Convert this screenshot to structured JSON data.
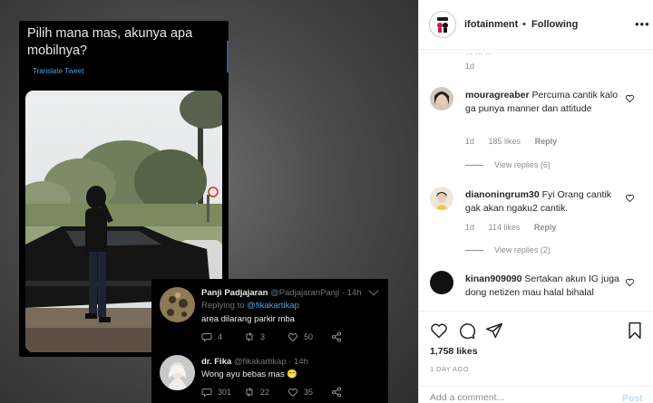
{
  "tweet": {
    "text": "Pilih mana mas, akunya apa mobilnya?",
    "translate": "Translate Tweet"
  },
  "replies": [
    {
      "name": "Panji Padjajaran",
      "handle": "@PadjajaranPanji · 14h",
      "replying_prefix": "Replying to ",
      "replying_to": "@fikakartikap",
      "text": "area dilarang parkir mba",
      "replies": "4",
      "retweets": "3",
      "likes": "50"
    },
    {
      "name": "dr. Fika",
      "handle": "@fikakartikap · 14h",
      "text": "Wong ayu bebas mas 😁",
      "replies": "301",
      "retweets": "22",
      "likes": "35"
    }
  ],
  "instagram": {
    "username": "ifotainment",
    "dot": "•",
    "follow_state": "Following",
    "faded_text": "... ... ...",
    "top_timestamp": "1d",
    "comments": [
      {
        "user": "mouragreaber",
        "text": "Percuma cantik kalo ga punya manner dan attitude",
        "age": "1d",
        "likes": "185 likes",
        "reply": "Reply",
        "view_replies": "View replies (6)"
      },
      {
        "user": "dianoningrum30",
        "text": "Fyi Orang cantik gak akan ngaku2 cantik.",
        "age": "1d",
        "likes": "114 likes",
        "reply": "Reply",
        "view_replies": "View replies (2)"
      },
      {
        "user": "kinan909090",
        "text": "Sertakan akun IG juga dong netizen mau halal bihalal"
      }
    ],
    "likes_total": "1,758 likes",
    "posted": "1 DAY AGO",
    "add_comment_placeholder": "Add a comment...",
    "post_label": "Post"
  },
  "colors": {
    "twitter_blue": "#4da3e6",
    "instagram_post": "#b2dffc"
  }
}
